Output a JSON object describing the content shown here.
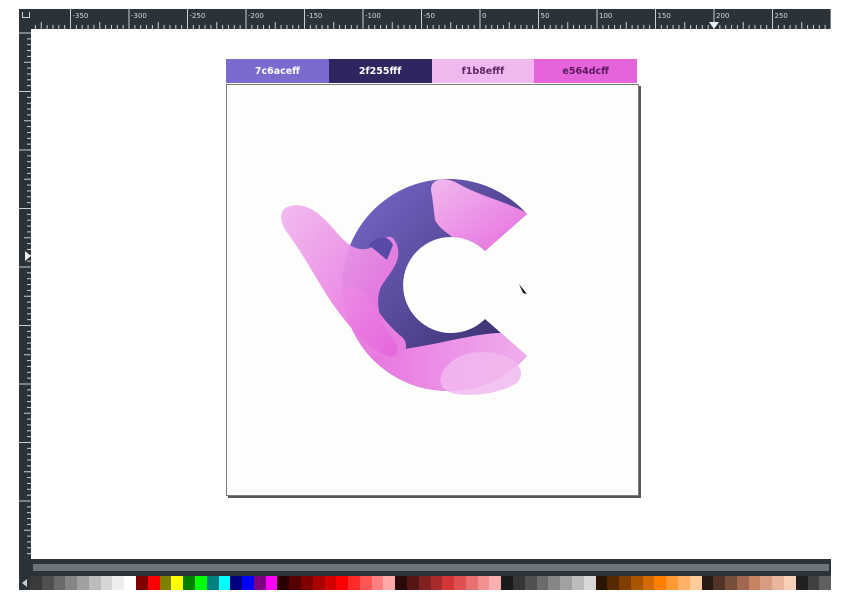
{
  "ruler": {
    "labels": [
      "-350",
      "-300",
      "-250",
      "-200",
      "-150",
      "-100",
      "-50",
      "0",
      "50",
      "100",
      "150",
      "200",
      "250"
    ]
  },
  "swatches": [
    {
      "label": "7c6aceff",
      "bg": "#7c6ace",
      "fg": "#ffffff"
    },
    {
      "label": "2f255fff",
      "bg": "#2f255f",
      "fg": "#ffffff"
    },
    {
      "label": "f1b8efff",
      "bg": "#f1b8ef",
      "fg": "#5a2a60"
    },
    {
      "label": "e564dcff",
      "bg": "#e564dc",
      "fg": "#5a1a5a"
    }
  ],
  "palette": [
    "#3a3a3a",
    "#505050",
    "#6a6a6a",
    "#858585",
    "#a0a0a0",
    "#bbbbbb",
    "#d6d6d6",
    "#eeeeee",
    "#ffffff",
    "#800000",
    "#ff0000",
    "#808000",
    "#ffff00",
    "#008000",
    "#00ff00",
    "#008080",
    "#00ffff",
    "#000080",
    "#0000ff",
    "#800080",
    "#ff00ff",
    "#2a0000",
    "#550000",
    "#800000",
    "#aa0000",
    "#d40000",
    "#ff0000",
    "#ff2a2a",
    "#ff5555",
    "#ff8080",
    "#ffaaaa",
    "#2a0a0a",
    "#551515",
    "#802020",
    "#aa2b2b",
    "#d43535",
    "#e05050",
    "#e87070",
    "#f09090",
    "#f8b0b0",
    "#1a1a1a",
    "#353535",
    "#505050",
    "#6b6b6b",
    "#868686",
    "#a1a1a1",
    "#bcbcbc",
    "#d7d7d7",
    "#2a1500",
    "#552a00",
    "#803f00",
    "#aa5500",
    "#d46a00",
    "#ff7f00",
    "#ff9933",
    "#ffb266",
    "#ffcc99",
    "#281a14",
    "#503428",
    "#784e3c",
    "#a06850",
    "#c88264",
    "#d89c80",
    "#e8b69c",
    "#f8d0b8",
    "#202020",
    "#404040",
    "#606060"
  ]
}
